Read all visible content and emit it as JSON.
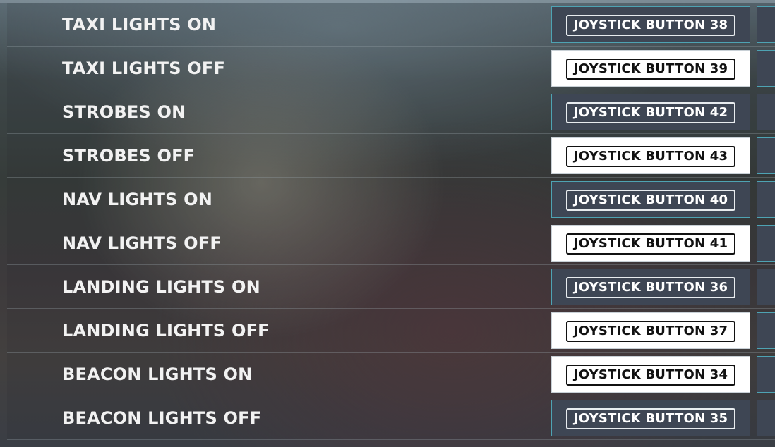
{
  "bindings": [
    {
      "action": "TAXI LIGHTS ON",
      "key": "JOYSTICK BUTTON 38",
      "selected": false
    },
    {
      "action": "TAXI LIGHTS OFF",
      "key": "JOYSTICK BUTTON 39",
      "selected": true
    },
    {
      "action": "STROBES ON",
      "key": "JOYSTICK BUTTON 42",
      "selected": false
    },
    {
      "action": "STROBES OFF",
      "key": "JOYSTICK BUTTON 43",
      "selected": true
    },
    {
      "action": "NAV LIGHTS ON",
      "key": "JOYSTICK BUTTON 40",
      "selected": false
    },
    {
      "action": "NAV LIGHTS OFF",
      "key": "JOYSTICK BUTTON 41",
      "selected": true
    },
    {
      "action": "LANDING LIGHTS ON",
      "key": "JOYSTICK BUTTON 36",
      "selected": false
    },
    {
      "action": "LANDING LIGHTS OFF",
      "key": "JOYSTICK BUTTON 37",
      "selected": true
    },
    {
      "action": "BEACON LIGHTS ON",
      "key": "JOYSTICK BUTTON 34",
      "selected": true
    },
    {
      "action": "BEACON LIGHTS OFF",
      "key": "JOYSTICK BUTTON 35",
      "selected": false
    }
  ],
  "colors": {
    "accent_border": "#4ea3b3",
    "cell_bg": "#3e4654",
    "cell_selected_bg": "#ffffff"
  }
}
